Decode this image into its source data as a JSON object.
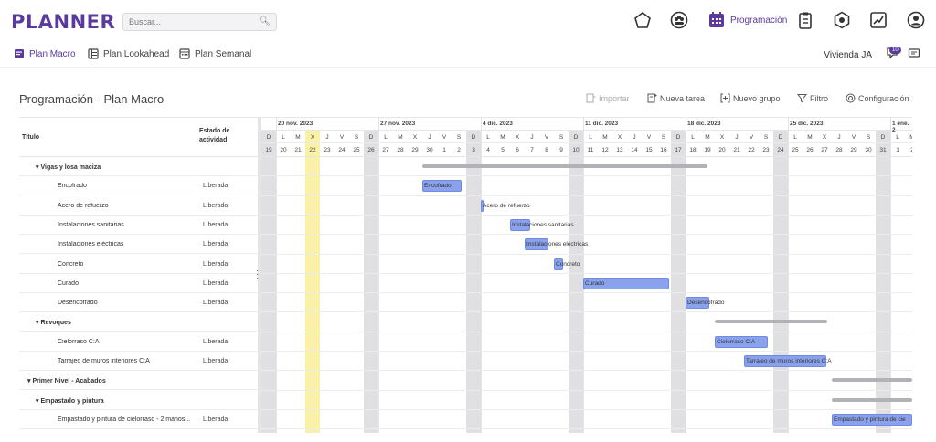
{
  "app": {
    "logo": "PLANNER"
  },
  "search": {
    "placeholder": "Buscar..."
  },
  "topnav": {
    "active_label": "Programación",
    "icons": [
      "home-pentagon-icon",
      "team-icon",
      "calendar-icon",
      "clipboard-icon",
      "hexagon-icon",
      "chart-line-icon",
      "user-circle-icon"
    ]
  },
  "subnav": {
    "tabs": [
      {
        "label": "Plan Macro",
        "icon": "plan-macro-icon"
      },
      {
        "label": "Plan Lookahead",
        "icon": "lookahead-icon"
      },
      {
        "label": "Plan Semanal",
        "icon": "weekly-icon"
      }
    ],
    "user": "Vivienda JA",
    "notifications": "10"
  },
  "page": {
    "title": "Programación - Plan Macro"
  },
  "toolbar": {
    "importar": "Importar",
    "nueva_tarea": "Nueva tarea",
    "nuevo_grupo": "Nuevo grupo",
    "filtro": "Filtro",
    "configuracion": "Configuración"
  },
  "table": {
    "col_title": "Título",
    "col_status": "Estado de actividad",
    "rows": [
      {
        "name": "▾  Vigas y losa maciza",
        "status": "",
        "type": "group",
        "indent": 1
      },
      {
        "name": "Encofrado",
        "status": "Liberada",
        "type": "task",
        "indent": 2
      },
      {
        "name": "Acero de refuerzo",
        "status": "Liberada",
        "type": "task",
        "indent": 2
      },
      {
        "name": "Instalaciones sanitarias",
        "status": "Liberada",
        "type": "task",
        "indent": 2
      },
      {
        "name": "Instalaciones eléctricas",
        "status": "Liberada",
        "type": "task",
        "indent": 2
      },
      {
        "name": "Concreto",
        "status": "Liberada",
        "type": "task",
        "indent": 2
      },
      {
        "name": "Curado",
        "status": "Liberada",
        "type": "task",
        "indent": 2
      },
      {
        "name": "Desencofrado",
        "status": "Liberada",
        "type": "task",
        "indent": 2
      },
      {
        "name": "▾  Revoques",
        "status": "",
        "type": "group",
        "indent": 1
      },
      {
        "name": "Cielorraso C:A",
        "status": "Liberada",
        "type": "task",
        "indent": 2
      },
      {
        "name": "Tarrajeo de muros interiores C:A",
        "status": "Liberada",
        "type": "task",
        "indent": 2
      },
      {
        "name": "▾  Primer Nivel - Acabados",
        "status": "",
        "type": "group",
        "indent": 0
      },
      {
        "name": "▾  Empastado y pintura",
        "status": "",
        "type": "group",
        "indent": 1
      },
      {
        "name": "Empastado y pintura de cielorraso - 2 manos...",
        "status": "Liberada",
        "type": "task",
        "indent": 2
      }
    ]
  },
  "timeline": {
    "weeks": [
      "20 nov. 2023",
      "27 nov. 2023",
      "4 dic. 2023",
      "11 dic. 2023",
      "18 dic. 2023",
      "25 dic. 2023",
      "1 ene. 2"
    ],
    "day_letters": [
      "D",
      "L",
      "M",
      "X",
      "J",
      "V",
      "S",
      "D",
      "L",
      "M",
      "X",
      "J",
      "V",
      "S",
      "D",
      "L",
      "M",
      "X",
      "J",
      "V",
      "S",
      "D",
      "L",
      "M",
      "X",
      "J",
      "V",
      "S",
      "D",
      "L",
      "M",
      "X",
      "J",
      "V",
      "S",
      "D",
      "L",
      "M",
      "X",
      "J",
      "V",
      "S",
      "D",
      "L",
      "M"
    ],
    "day_numbers": [
      "19",
      "20",
      "21",
      "22",
      "23",
      "24",
      "25",
      "26",
      "27",
      "28",
      "29",
      "30",
      "1",
      "2",
      "3",
      "4",
      "5",
      "6",
      "7",
      "8",
      "9",
      "10",
      "11",
      "12",
      "13",
      "14",
      "15",
      "16",
      "17",
      "18",
      "19",
      "20",
      "21",
      "22",
      "23",
      "24",
      "25",
      "26",
      "27",
      "28",
      "29",
      "30",
      "31",
      "1",
      "2"
    ],
    "today_index": 3,
    "tasks": [
      {
        "row": 0,
        "kind": "summary",
        "start": 11,
        "end": 30.5
      },
      {
        "row": 1,
        "kind": "bar",
        "start": 11,
        "end": 13.7,
        "label": "Encofrado"
      },
      {
        "row": 2,
        "kind": "bar",
        "start": 15,
        "end": 15.2,
        "label": "Acero de refuerzo"
      },
      {
        "row": 3,
        "kind": "bar",
        "start": 17,
        "end": 18.4,
        "label": "Instalaciones sanitarias"
      },
      {
        "row": 4,
        "kind": "bar",
        "start": 18,
        "end": 19.6,
        "label": "Instalaciones eléctricas"
      },
      {
        "row": 5,
        "kind": "bar",
        "start": 20,
        "end": 20.6,
        "label": "Concreto"
      },
      {
        "row": 6,
        "kind": "bar",
        "start": 22,
        "end": 27.9,
        "label": "Curado"
      },
      {
        "row": 7,
        "kind": "bar",
        "start": 29,
        "end": 30.6,
        "label": "Desencofrado"
      },
      {
        "row": 8,
        "kind": "summary",
        "start": 31,
        "end": 38.7
      },
      {
        "row": 9,
        "kind": "bar",
        "start": 31,
        "end": 34.6,
        "label": "Cielorraso C:A"
      },
      {
        "row": 10,
        "kind": "bar",
        "start": 33,
        "end": 38.6,
        "label": "Tarrajeo de muros interiores C:A"
      },
      {
        "row": 11,
        "kind": "summary",
        "start": 39,
        "end": 44.5
      },
      {
        "row": 12,
        "kind": "summary",
        "start": 39,
        "end": 44.5
      },
      {
        "row": 13,
        "kind": "bar",
        "start": 39,
        "end": 44.5,
        "label": "Empastado y pintura de cie"
      }
    ]
  },
  "colors": {
    "accent": "#5b3a9e",
    "bar": "#8aa2ec",
    "today": "#fbf0a8",
    "weekend": "#e0e0e2"
  }
}
